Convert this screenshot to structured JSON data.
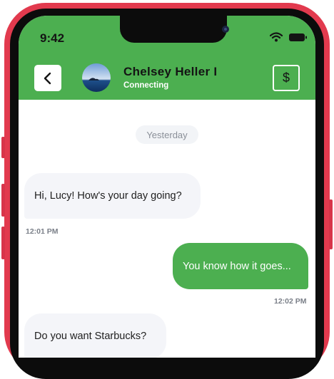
{
  "status_bar": {
    "time": "9:42"
  },
  "header": {
    "contact_name": "Chelsey Heller I",
    "contact_status": "Connecting",
    "pay_symbol": "$",
    "back_icon": "chevron-left-icon",
    "pay_icon": "dollar-icon"
  },
  "conversation": {
    "date_separator": "Yesterday",
    "messages": [
      {
        "direction": "incoming",
        "text": "Hi, Lucy! How's your day going?",
        "time": "12:01 PM"
      },
      {
        "direction": "outgoing",
        "text": "You know how it goes...",
        "time": "12:02 PM"
      },
      {
        "direction": "incoming",
        "text": "Do you want Starbucks?",
        "time": ""
      }
    ]
  },
  "colors": {
    "header": "#4caf50",
    "outgoing_bubble": "#4caf50",
    "incoming_bubble": "#f4f5f9",
    "frame": "#e23a4e"
  }
}
